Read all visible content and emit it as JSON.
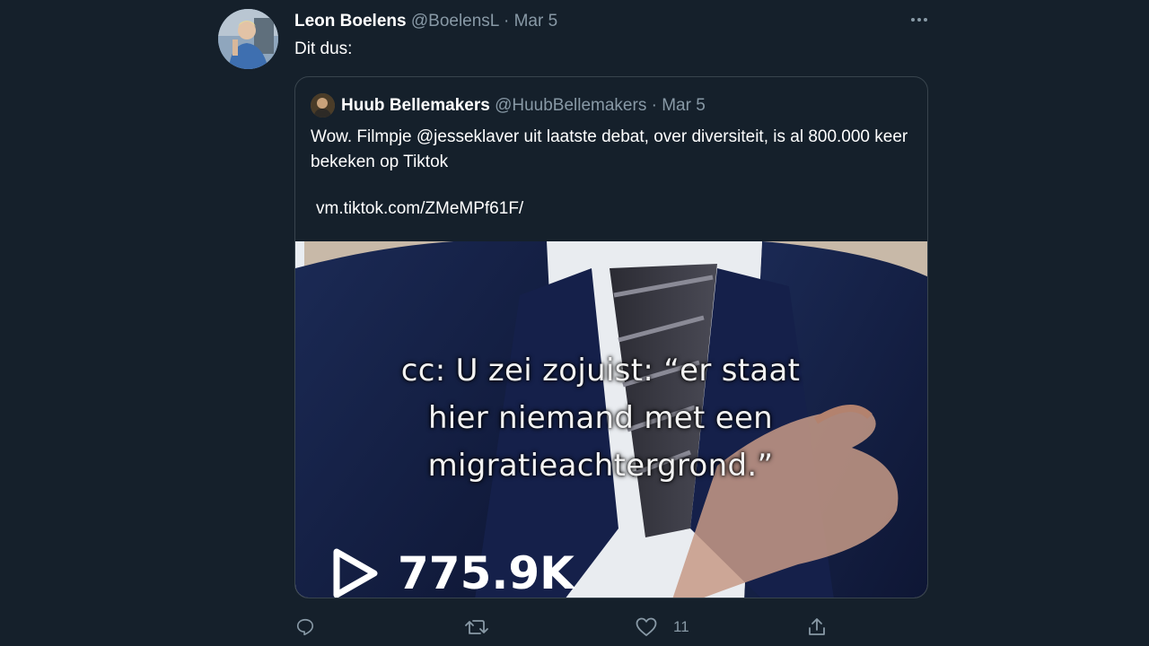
{
  "tweet": {
    "author_name": "Leon Boelens",
    "author_handle": "@BoelensL",
    "separator": "·",
    "date": "Mar 5",
    "text": "Dit dus:"
  },
  "quoted_tweet": {
    "author_name": "Huub Bellemakers",
    "author_handle": "@HuubBellemakers",
    "separator": "·",
    "date": "Mar 5",
    "text": "Wow. Filmpje @jesseklaver uit laatste debat, over diversiteit, is al 800.000 keer bekeken op Tiktok",
    "link": "vm.tiktok.com/ZMeMPf61F/",
    "media": {
      "caption": "cc: U zei zojuist: “er staat hier niemand met een migratieachtergrond.”",
      "view_count": "775.9K"
    }
  },
  "actions": {
    "reply_icon": "reply-icon",
    "retweet_icon": "retweet-icon",
    "like_icon": "heart-icon",
    "like_count": "11",
    "share_icon": "share-icon"
  },
  "colors": {
    "background": "#15202b",
    "border": "#38444d",
    "muted_text": "#8899a6",
    "text": "#ffffff"
  }
}
